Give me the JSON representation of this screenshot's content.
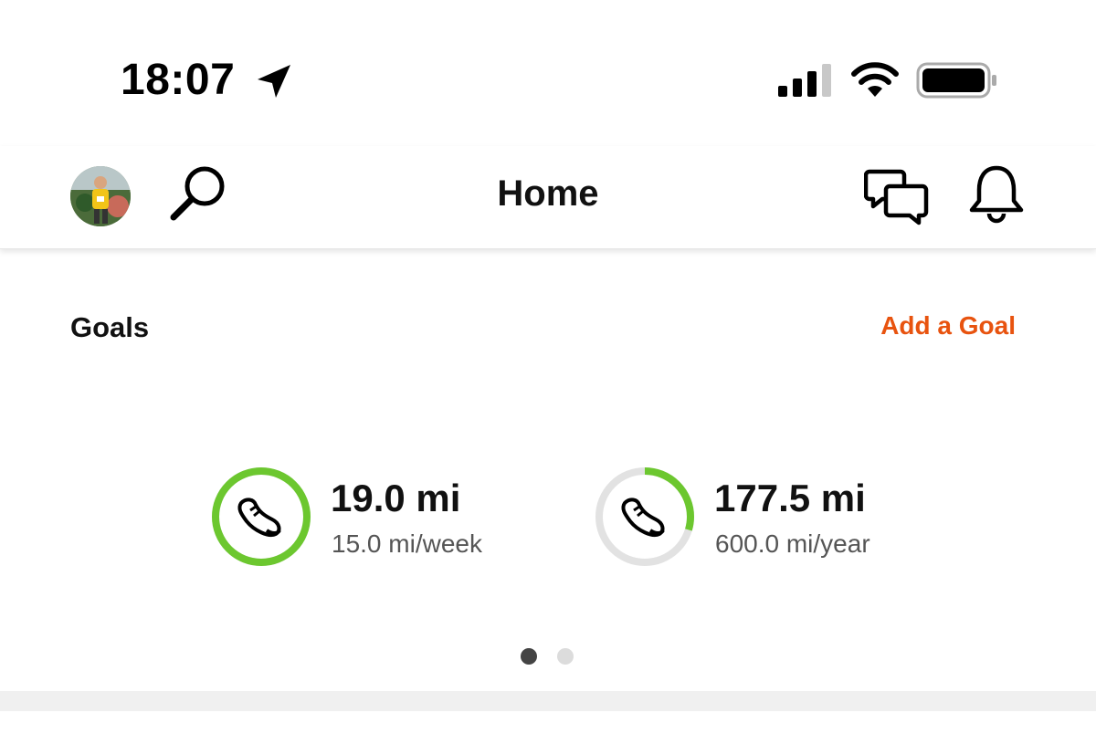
{
  "status_bar": {
    "time": "18:07",
    "icons": [
      "location-arrow-icon",
      "cellular-signal-icon",
      "wifi-icon",
      "battery-icon"
    ]
  },
  "header": {
    "title": "Home",
    "icons": [
      "avatar",
      "search-icon",
      "messages-icon",
      "bell-icon"
    ]
  },
  "goals": {
    "title": "Goals",
    "add_label": "Add a Goal",
    "items": [
      {
        "value": "19.0 mi",
        "target": "15.0 mi/week",
        "progress": 1.0,
        "icon": "shoe-icon"
      },
      {
        "value": "177.5 mi",
        "target": "600.0 mi/year",
        "progress": 0.296,
        "icon": "shoe-icon"
      }
    ],
    "pager": {
      "pages": 2,
      "active": 1
    }
  },
  "colors": {
    "accent": "#e8530f",
    "progress": "#6cc72f",
    "track": "#e2e2e2"
  }
}
